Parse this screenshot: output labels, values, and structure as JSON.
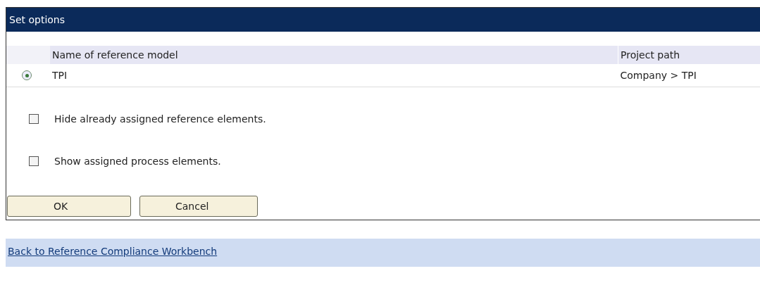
{
  "panel": {
    "title": "Set options"
  },
  "table": {
    "columns": [
      "Name of reference model",
      "Project path"
    ],
    "rows": [
      {
        "selected": true,
        "cells": [
          "TPI",
          "Company > TPI"
        ]
      }
    ]
  },
  "options": [
    {
      "label": "Hide already assigned reference elements.",
      "checked": false
    },
    {
      "label": "Show assigned process elements.",
      "checked": false
    }
  ],
  "buttons": [
    "OK",
    "Cancel"
  ],
  "footer_link": "Back to Reference Compliance Workbench"
}
